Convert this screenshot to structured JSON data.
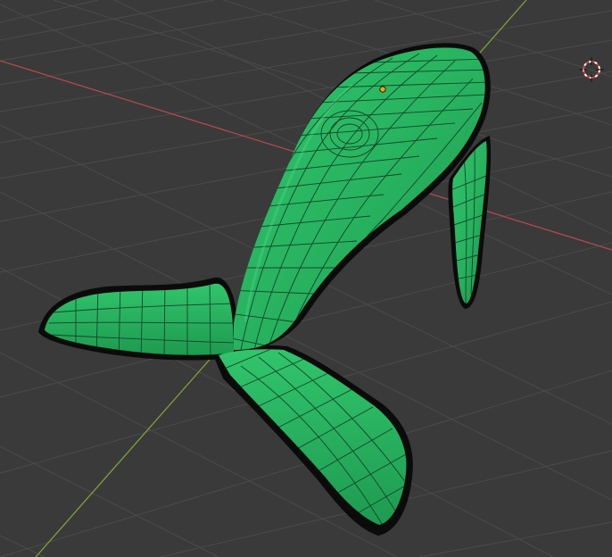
{
  "viewport": {
    "mode": "object",
    "background_color": "#3a3a3a",
    "grid_color": "#4b4b4b",
    "x_axis_color": "#b24a4f",
    "y_axis_color": "#7ea13a"
  },
  "mesh": {
    "shape": "whale",
    "fill_color": "#27b15e",
    "edge_color": "#16452a",
    "outline_color": "#0b0b0b",
    "wireframe": true
  },
  "gizmos": {
    "cursor_icon": "3d-cursor-icon",
    "origin_icon": "object-origin-icon",
    "origin_color": "#f0a020"
  }
}
